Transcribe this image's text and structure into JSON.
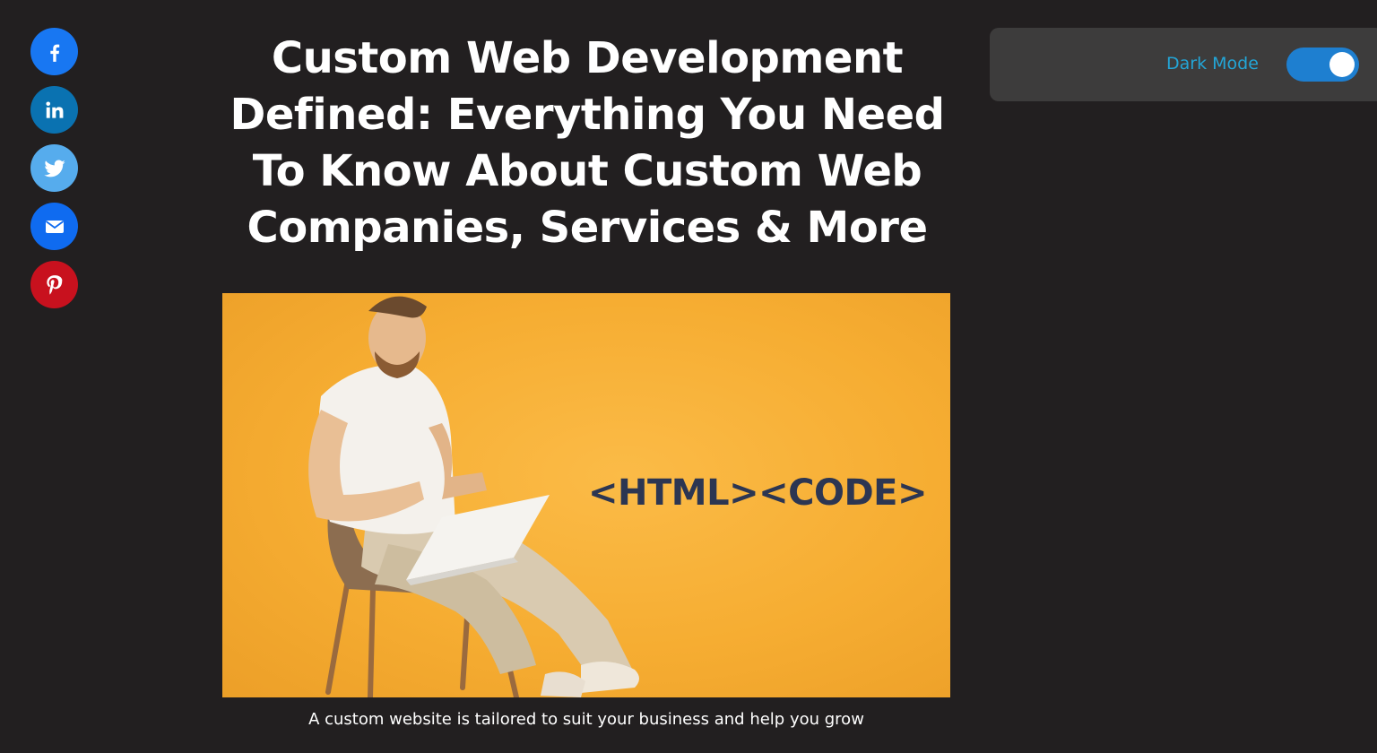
{
  "article": {
    "title": "Custom Web Development Defined: Everything You Need To Know About Custom Web Companies, Services & More",
    "hero_image_text": "<HTML><CODE>",
    "caption": "A custom website is tailored to suit your business and help you grow"
  },
  "share": {
    "buttons": [
      {
        "network": "facebook",
        "icon": "facebook-icon",
        "color": "#1877f2"
      },
      {
        "network": "linkedin",
        "icon": "linkedin-icon",
        "color": "#0a72b1"
      },
      {
        "network": "twitter",
        "icon": "twitter-icon",
        "color": "#56aced"
      },
      {
        "network": "email",
        "icon": "email-icon",
        "color": "#0f6bf0"
      },
      {
        "network": "pinterest",
        "icon": "pinterest-icon",
        "color": "#c8111e"
      }
    ]
  },
  "dark_mode": {
    "label": "Dark Mode",
    "enabled": true,
    "toggle_color": "#1e7fd0",
    "label_color": "#23a5d6"
  },
  "colors": {
    "background": "#221f20",
    "hero_bg": "#f6ad32",
    "panel_bg": "#3d3c3c"
  }
}
